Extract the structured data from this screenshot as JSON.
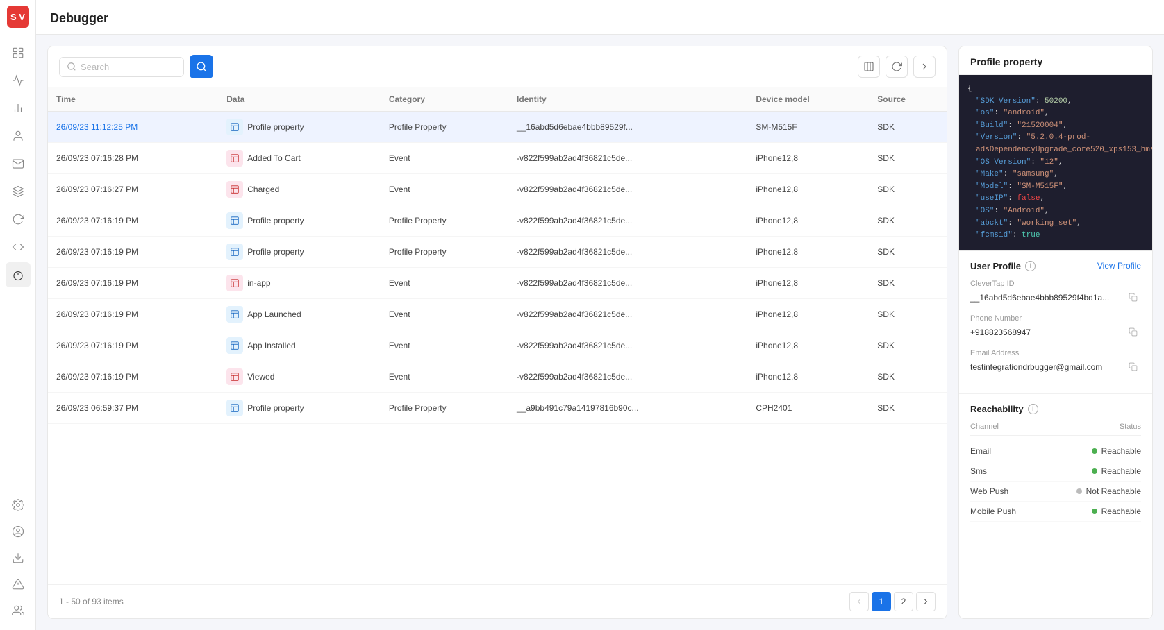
{
  "app": {
    "title": "Debugger"
  },
  "sidebar": {
    "logo": "S V",
    "items": [
      {
        "id": "grid",
        "icon": "grid"
      },
      {
        "id": "activity",
        "icon": "activity"
      },
      {
        "id": "chart",
        "icon": "chart"
      },
      {
        "id": "user",
        "icon": "user"
      },
      {
        "id": "mail",
        "icon": "mail"
      },
      {
        "id": "layers",
        "icon": "layers"
      },
      {
        "id": "refresh",
        "icon": "refresh"
      },
      {
        "id": "code",
        "icon": "code"
      },
      {
        "id": "message",
        "icon": "message"
      }
    ],
    "bottom_items": [
      {
        "id": "settings",
        "icon": "settings"
      },
      {
        "id": "debug",
        "icon": "debug"
      },
      {
        "id": "download",
        "icon": "download"
      },
      {
        "id": "alert",
        "icon": "alert"
      },
      {
        "id": "users2",
        "icon": "users2"
      }
    ]
  },
  "toolbar": {
    "search_placeholder": "Search",
    "search_value": ""
  },
  "table": {
    "columns": [
      "Time",
      "Data",
      "Category",
      "Identity",
      "Device model",
      "Source"
    ],
    "rows": [
      {
        "time": "26/09/23 11:12:25 PM",
        "time_highlighted": true,
        "data_icon": "blue",
        "data": "Profile property",
        "category": "Profile Property",
        "identity": "__16abd5d6ebae4bbb89529f...",
        "device": "SM-M515F",
        "source": "SDK",
        "selected": true
      },
      {
        "time": "26/09/23 07:16:28 PM",
        "time_highlighted": false,
        "data_icon": "pink",
        "data": "Added To Cart",
        "category": "Event",
        "identity": "-v822f599ab2ad4f36821c5de...",
        "device": "iPhone12,8",
        "source": "SDK",
        "selected": false
      },
      {
        "time": "26/09/23 07:16:27 PM",
        "time_highlighted": false,
        "data_icon": "pink",
        "data": "Charged",
        "category": "Event",
        "identity": "-v822f599ab2ad4f36821c5de...",
        "device": "iPhone12,8",
        "source": "SDK",
        "selected": false
      },
      {
        "time": "26/09/23 07:16:19 PM",
        "time_highlighted": false,
        "data_icon": "blue",
        "data": "Profile property",
        "category": "Profile Property",
        "identity": "-v822f599ab2ad4f36821c5de...",
        "device": "iPhone12,8",
        "source": "SDK",
        "selected": false
      },
      {
        "time": "26/09/23 07:16:19 PM",
        "time_highlighted": false,
        "data_icon": "blue",
        "data": "Profile property",
        "category": "Profile Property",
        "identity": "-v822f599ab2ad4f36821c5de...",
        "device": "iPhone12,8",
        "source": "SDK",
        "selected": false
      },
      {
        "time": "26/09/23 07:16:19 PM",
        "time_highlighted": false,
        "data_icon": "pink",
        "data": "in-app",
        "category": "Event",
        "identity": "-v822f599ab2ad4f36821c5de...",
        "device": "iPhone12,8",
        "source": "SDK",
        "selected": false
      },
      {
        "time": "26/09/23 07:16:19 PM",
        "time_highlighted": false,
        "data_icon": "blue",
        "data": "App Launched",
        "category": "Event",
        "identity": "-v822f599ab2ad4f36821c5de...",
        "device": "iPhone12,8",
        "source": "SDK",
        "selected": false
      },
      {
        "time": "26/09/23 07:16:19 PM",
        "time_highlighted": false,
        "data_icon": "blue",
        "data": "App Installed",
        "category": "Event",
        "identity": "-v822f599ab2ad4f36821c5de...",
        "device": "iPhone12,8",
        "source": "SDK",
        "selected": false
      },
      {
        "time": "26/09/23 07:16:19 PM",
        "time_highlighted": false,
        "data_icon": "pink",
        "data": "Viewed",
        "category": "Event",
        "identity": "-v822f599ab2ad4f36821c5de...",
        "device": "iPhone12,8",
        "source": "SDK",
        "selected": false
      },
      {
        "time": "26/09/23 06:59:37 PM",
        "time_highlighted": false,
        "data_icon": "blue",
        "data": "Profile property",
        "category": "Profile Property",
        "identity": "__a9bb491c79a14197816b90c...",
        "device": "CPH2401",
        "source": "SDK",
        "selected": false
      }
    ],
    "pagination": {
      "info": "1 - 50 of 93 items",
      "current_page": 1,
      "total_pages": 2
    }
  },
  "right_panel": {
    "title": "Profile property",
    "json_lines": [
      {
        "type": "bracket",
        "text": "{"
      },
      {
        "type": "kv",
        "key": "\"SDK Version\"",
        "value": "50200",
        "value_type": "num"
      },
      {
        "type": "kv",
        "key": "\"os\"",
        "value": "\"android\"",
        "value_type": "str"
      },
      {
        "type": "kv",
        "key": "\"Build\"",
        "value": "\"21520004\"",
        "value_type": "str"
      },
      {
        "type": "kv",
        "key": "\"Version\"",
        "value": "\"5.2.0.4-prod-adsDependencyUpgrade_core520_xps153_hms\"",
        "value_type": "str"
      },
      {
        "type": "kv",
        "key": "\"OS Version\"",
        "value": "\"12\"",
        "value_type": "str"
      },
      {
        "type": "kv",
        "key": "\"Make\"",
        "value": "\"samsung\"",
        "value_type": "str"
      },
      {
        "type": "kv",
        "key": "\"Model\"",
        "value": "\"SM-M515F\"",
        "value_type": "str"
      },
      {
        "type": "kv",
        "key": "\"useIP\"",
        "value": "false",
        "value_type": "bool_false"
      },
      {
        "type": "kv",
        "key": "\"OS\"",
        "value": "\"Android\"",
        "value_type": "str"
      },
      {
        "type": "kv",
        "key": "\"abckt\"",
        "value": "\"working_set\"",
        "value_type": "str"
      },
      {
        "type": "kv",
        "key": "\"fcmsid\"",
        "value": "true",
        "value_type": "bool_true"
      }
    ],
    "user_profile": {
      "label": "User Profile",
      "view_profile_btn": "View Profile",
      "clevertap_id_label": "CleverTap ID",
      "clevertap_id_value": "__16abd5d6ebae4bbb89529f4bd1a...",
      "phone_label": "Phone Number",
      "phone_value": "+918823568947",
      "email_label": "Email Address",
      "email_value": "testintegrationdrbugger@gmail.com"
    },
    "reachability": {
      "label": "Reachability",
      "channel_header": "Channel",
      "status_header": "Status",
      "channels": [
        {
          "name": "Email",
          "status": "Reachable",
          "reachable": true
        },
        {
          "name": "Sms",
          "status": "Reachable",
          "reachable": true
        },
        {
          "name": "Web Push",
          "status": "Not Reachable",
          "reachable": false
        },
        {
          "name": "Mobile Push",
          "status": "Reachable",
          "reachable": true
        }
      ]
    }
  }
}
